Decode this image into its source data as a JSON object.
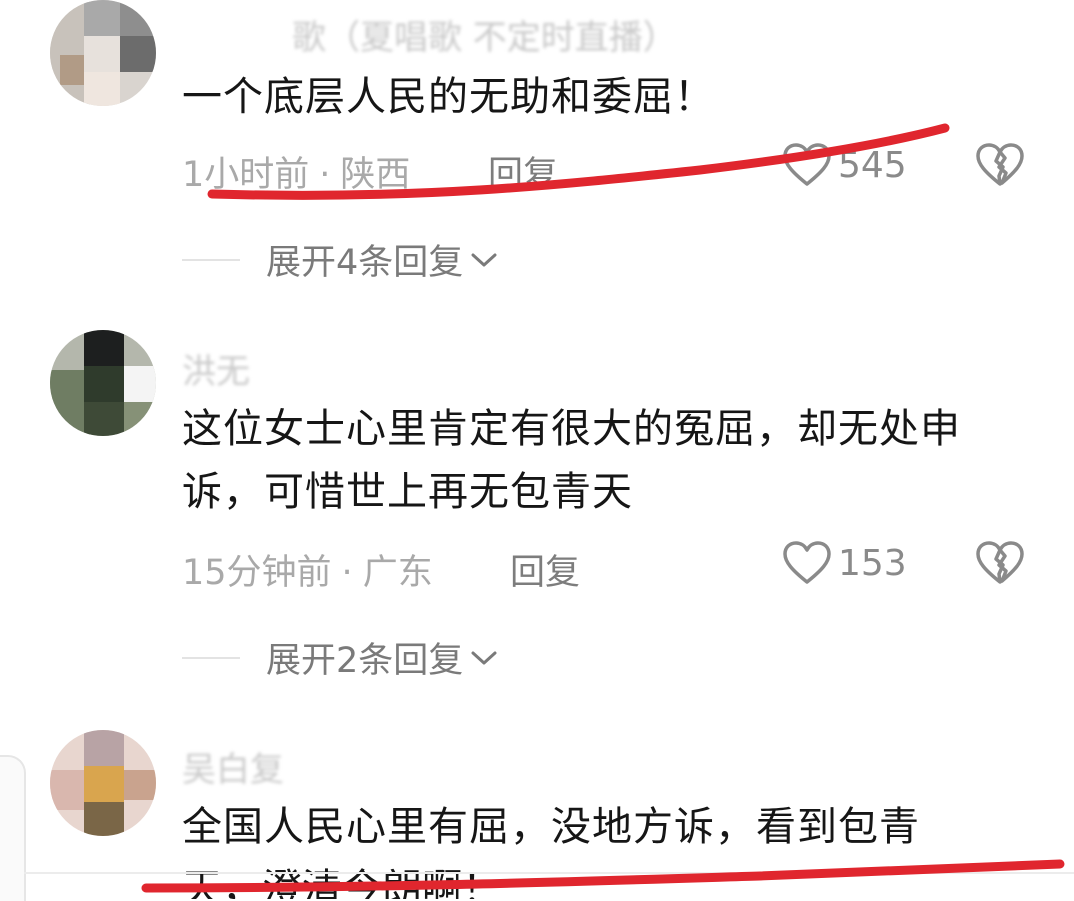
{
  "comments": [
    {
      "username": "歌（夏唱歌 不定时直播）",
      "text": "一个底层人民的无助和委屈！",
      "time": "1小时前",
      "location": "陕西",
      "reply_label": "回复",
      "likes": "545",
      "expand_label": "展开4条回复"
    },
    {
      "username": "洪无",
      "text": "这位女士心里肯定有很大的冤屈，却无处申诉，可惜世上再无包青天",
      "time": "15分钟前",
      "location": "广东",
      "reply_label": "回复",
      "likes": "153",
      "expand_label": "展开2条回复"
    },
    {
      "username": "吴白复",
      "text": "全国人民心里有屈，没地方诉，看到包青",
      "text_cut": "天，澄清今朗啊！"
    }
  ],
  "separator": "·",
  "annotation_color": "#e0262e",
  "icons": {
    "like": "heart-outline-icon",
    "dislike": "broken-heart-icon",
    "expand": "chevron-down-icon"
  }
}
